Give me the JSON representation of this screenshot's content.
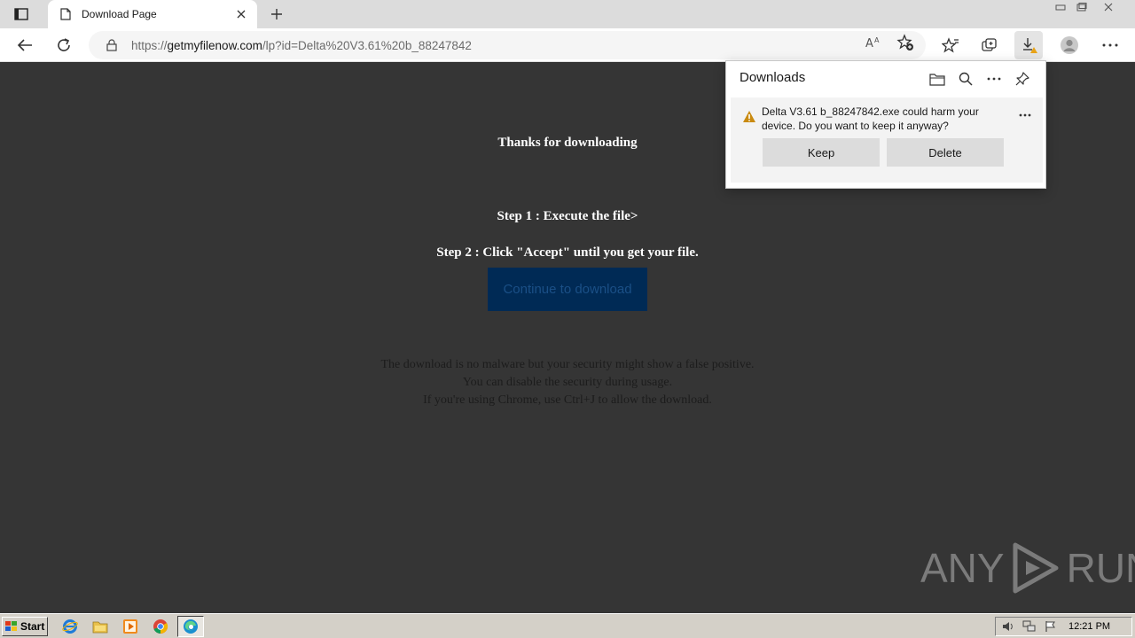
{
  "browser": {
    "tab": {
      "title": "Download Page",
      "favicon": "page-icon"
    },
    "address": {
      "scheme": "https://",
      "host": "getmyfilenow.com",
      "path": "/lp?id=Delta%20V3.61%20b_88247842"
    },
    "toolbar_icons": [
      "back-icon",
      "refresh-icon",
      "read-aloud-icon",
      "add-favorite-icon",
      "favorites-icon",
      "collections-icon",
      "downloads-icon",
      "profile-icon",
      "more-icon"
    ]
  },
  "page": {
    "heading": "Thanks for downloading",
    "step1": "Step 1 : Execute the file>",
    "step2": "Step 2 : Click \"Accept\" until you get your file.",
    "cta_label": "Continue to download",
    "notes": [
      "The download is no malware but your security might show a false positive.",
      "You can disable the security during usage.",
      "If you're using Chrome, use Ctrl+J to allow the download."
    ]
  },
  "downloads_flyout": {
    "title": "Downloads",
    "item_message": "Delta V3.61 b_88247842.exe could harm your device. Do you want to keep it anyway?",
    "keep_label": "Keep",
    "delete_label": "Delete",
    "icons": [
      "folder-icon",
      "search-icon",
      "more-icon",
      "pin-icon",
      "warning-icon"
    ]
  },
  "watermark": {
    "left": "ANY",
    "right": "RUN"
  },
  "taskbar": {
    "start_label": "Start",
    "clock": "12:21 PM",
    "apps": [
      "ie-icon",
      "explorer-icon",
      "media-player-icon",
      "chrome-icon",
      "edge-icon"
    ]
  },
  "colors": {
    "page_bg": "#353535",
    "cta_bg": "#002a55",
    "taskbar_bg": "#d4d0c8"
  }
}
